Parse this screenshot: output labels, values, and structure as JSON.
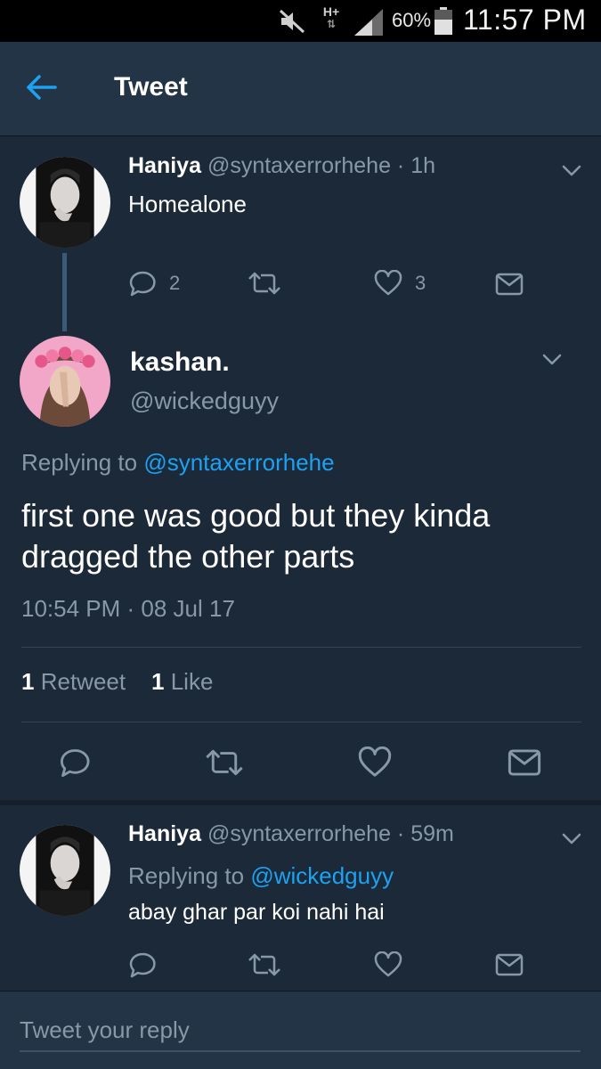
{
  "status_bar": {
    "network": "H+",
    "battery": "60%",
    "time": "11:57 PM",
    "icons": [
      "mute-icon",
      "network-icon",
      "signal-icon",
      "battery-icon"
    ]
  },
  "app_bar": {
    "title": "Tweet",
    "back_icon": "arrow-left-icon"
  },
  "colors": {
    "background": "#1c2938",
    "header": "#243447",
    "accent": "#1da1f2",
    "muted": "#8899a6"
  },
  "parent_tweet": {
    "name": "Haniya",
    "handle": "@syntaxerrorhehe",
    "separator": "·",
    "time": "1h",
    "text": "Homealone",
    "replies": "2",
    "likes": "3"
  },
  "main_tweet": {
    "name": "kashan.",
    "handle": "@wickedguyy",
    "replying_prefix": "Replying to",
    "replying_handle": "@syntaxerrorhehe",
    "text": "first one was good but they kinda dragged the other parts",
    "timestamp": "10:54 PM · 08 Jul 17",
    "retweet_count": "1",
    "retweet_label": "Retweet",
    "like_count": "1",
    "like_label": "Like"
  },
  "reply_tweet": {
    "name": "Haniya",
    "handle": "@syntaxerrorhehe",
    "separator": "·",
    "time": "59m",
    "replying_prefix": "Replying to",
    "replying_handle": "@wickedguyy",
    "text": "abay ghar par koi nahi hai"
  },
  "composer": {
    "placeholder": "Tweet your reply"
  }
}
